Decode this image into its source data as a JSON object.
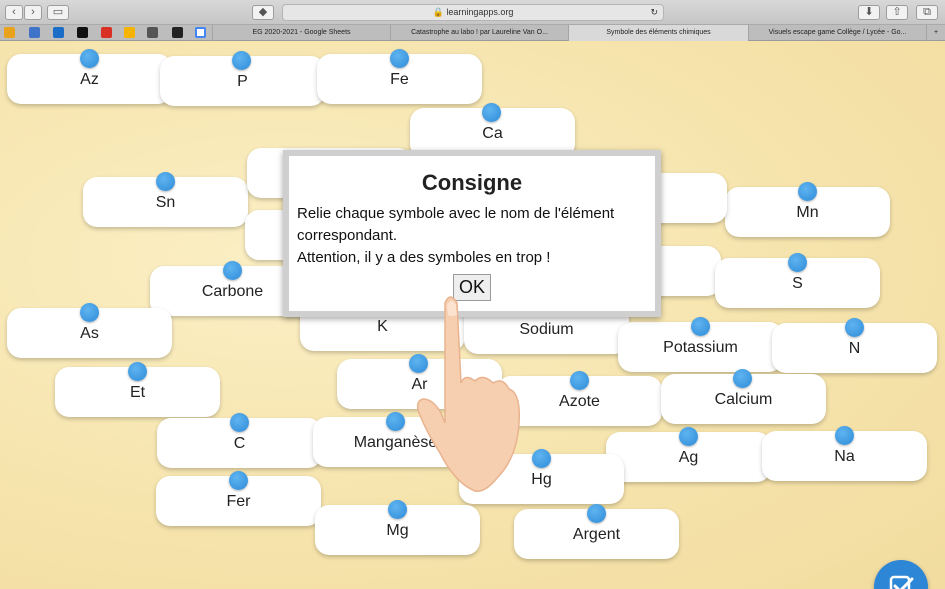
{
  "browser": {
    "url": "learningapps.org",
    "tabs": [
      {
        "title": "EG 2020-2021 - Google Sheets"
      },
      {
        "title": "Catastrophe au labo ! par Laureline Van O..."
      },
      {
        "title": "Symbole des éléments chimiques"
      },
      {
        "title": "Visuels escape game Collège / Lycée - Go..."
      }
    ],
    "nav_icons": [
      "back-icon",
      "forward-icon",
      "sidebar-icon",
      "tag-icon",
      "reload-icon",
      "download-icon",
      "share-icon",
      "new-tab-icon"
    ]
  },
  "dialog": {
    "title": "Consigne",
    "line1": "Relie chaque symbole avec le nom de l'élément correspondant.",
    "line2": "Attention, il y a des symboles en trop !",
    "ok_label": "OK"
  },
  "cards": [
    {
      "label": "Az"
    },
    {
      "label": "P"
    },
    {
      "label": "Fe"
    },
    {
      "label": "Ca"
    },
    {
      "label": "Sn"
    },
    {
      "label": ""
    },
    {
      "label": ""
    },
    {
      "label": "Mn"
    },
    {
      "label": ""
    },
    {
      "label": ""
    },
    {
      "label": "S"
    },
    {
      "label": "Carbone"
    },
    {
      "label": "As"
    },
    {
      "label": "K"
    },
    {
      "label": "Sodium"
    },
    {
      "label": "Potassium"
    },
    {
      "label": "N"
    },
    {
      "label": "Et"
    },
    {
      "label": "Ar"
    },
    {
      "label": "Azote"
    },
    {
      "label": "Calcium"
    },
    {
      "label": "C"
    },
    {
      "label": "Manganèse"
    },
    {
      "label": "Ag"
    },
    {
      "label": "Na"
    },
    {
      "label": "Hg"
    },
    {
      "label": "Fer"
    },
    {
      "label": "Mg"
    },
    {
      "label": "Argent"
    }
  ],
  "colors": {
    "accent": "#2e86d6",
    "background": "#f5e6b3",
    "dot": "#3d9ae2"
  }
}
